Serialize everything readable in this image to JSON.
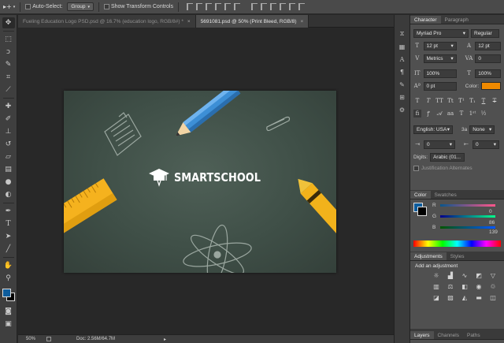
{
  "options_bar": {
    "move_tool_glyph": "▸+",
    "auto_select_label": "Auto-Select:",
    "auto_select_target": "Group",
    "show_transform_label": "Show Transform Controls"
  },
  "tabs": [
    {
      "label": "Fueling Education Logo PSD.psd @ 16.7% (education logo, RGB/8#) *",
      "active": false
    },
    {
      "label": "5691081.psd @ 50% (Print Bleed, RGB/8)",
      "active": true
    }
  ],
  "canvas": {
    "logo_text": "SMARTSCHOOL"
  },
  "status": {
    "zoom": "50%",
    "doc_info": "Doc: 2.56M/64.7M"
  },
  "colors": {
    "foreground": "#0d5c9c",
    "background": "#000000",
    "board": "#3f4f47",
    "pencil_blue": "#3d8fd6",
    "crayon_yellow": "#f2b21b",
    "ruler_yellow": "#f5b21e",
    "font_color_swatch": "#f08a00"
  },
  "character_panel": {
    "tab_active": "Character",
    "tab_other": "Paragraph",
    "font_family": "Myriad Pro",
    "font_style": "Regular",
    "font_size": "12 pt",
    "leading": "12 pt",
    "kerning": "Metrics",
    "tracking": "0",
    "vertical_scale": "100%",
    "horizontal_scale": "100%",
    "baseline_shift": "0 pt",
    "color_label": "Color:",
    "language": "English: USA",
    "anti_alias_value": "3a",
    "anti_alias": "None",
    "field_a": "0",
    "field_b": "0",
    "digits_label": "Digits:",
    "digits_value": "Arabic (01...",
    "justification": "Justification Alternates"
  },
  "color_panel": {
    "tab_active": "Color",
    "tab_other": "Swatches",
    "r_label": "R",
    "g_label": "G",
    "b_label": "B",
    "r_value": "0",
    "g_value": "86",
    "b_value": "139"
  },
  "adjustments_panel": {
    "tab_active": "Adjustments",
    "tab_other": "Styles",
    "heading": "Add an adjustment"
  },
  "layers_panel": {
    "tabs": [
      "Layers",
      "Channels",
      "Paths"
    ]
  },
  "tool_icons": [
    "move-icon",
    "marquee-icon",
    "lasso-icon",
    "quick-select-icon",
    "crop-icon",
    "eyedropper-icon",
    "healing-icon",
    "brush-icon",
    "stamp-icon",
    "history-brush-icon",
    "eraser-icon",
    "gradient-icon",
    "blur-icon",
    "dodge-icon",
    "pen-icon",
    "type-icon",
    "path-select-icon",
    "line-icon",
    "hand-icon",
    "zoom-icon"
  ]
}
